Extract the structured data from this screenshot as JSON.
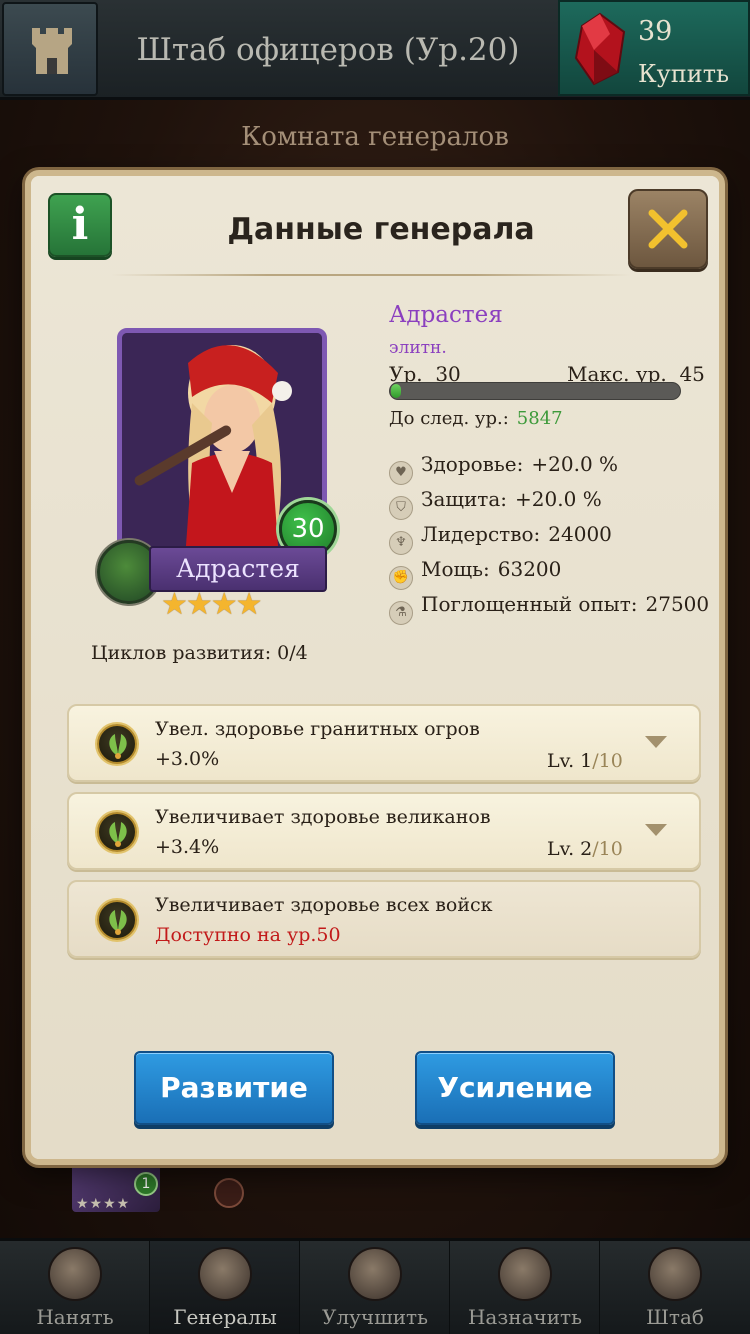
{
  "header": {
    "title": "Штаб офицеров (Ур.20)",
    "gems": "39",
    "buy_label": "Купить"
  },
  "room_title": "Комната генералов",
  "modal": {
    "title": "Данные генерала",
    "info_label": "i",
    "general": {
      "name": "Адрастея",
      "rarity": "элитн.",
      "level_label": "Ур.  30",
      "max_level_label": "Макс. ур.  45",
      "level": 30,
      "max_level": 45,
      "xp_progress": 0.03,
      "next_level_label": "До след. ур.:",
      "next_level_value": "5847",
      "card_name": "Адрастея",
      "card_level": "30",
      "stars": "★★★★"
    },
    "stats": [
      {
        "icon": "heart-icon",
        "label": "Здоровье:",
        "value": "+20.0 %"
      },
      {
        "icon": "shield-icon",
        "label": "Защита:",
        "value": "+20.0 %"
      },
      {
        "icon": "leadership-icon",
        "label": "Лидерство:",
        "value": "24000"
      },
      {
        "icon": "fist-icon",
        "label": "Мощь:",
        "value": "63200"
      },
      {
        "icon": "potion-icon",
        "label": "Поглощенный опыт:",
        "value": "27500"
      }
    ],
    "cycles_label": "Циклов развития: 0/4",
    "skills": [
      {
        "name": "Увел. здоровье гранитных огров",
        "value": "+3.0%",
        "level": "Lv. 1",
        "max": "/10"
      },
      {
        "name": "Увеличивает здоровье великанов",
        "value": "+3.4%",
        "level": "Lv. 2",
        "max": "/10"
      },
      {
        "name": "Увеличивает здоровье всех войск",
        "value": "Доступно на ур.50"
      }
    ],
    "buttons": {
      "develop": "Развитие",
      "boost": "Усиление"
    }
  },
  "background_list": {
    "badge": "1",
    "stars": "★★★★"
  },
  "bottom_nav": [
    {
      "label": "Нанять"
    },
    {
      "label": "Генералы"
    },
    {
      "label": "Улучшить"
    },
    {
      "label": "Назначить"
    },
    {
      "label": "Штаб"
    }
  ],
  "colors": {
    "accent_blue": "#1f7fcf",
    "rarity_purple": "#8b3fbf",
    "locked_red": "#c21a1a",
    "xp_green": "#3d9a3a"
  }
}
